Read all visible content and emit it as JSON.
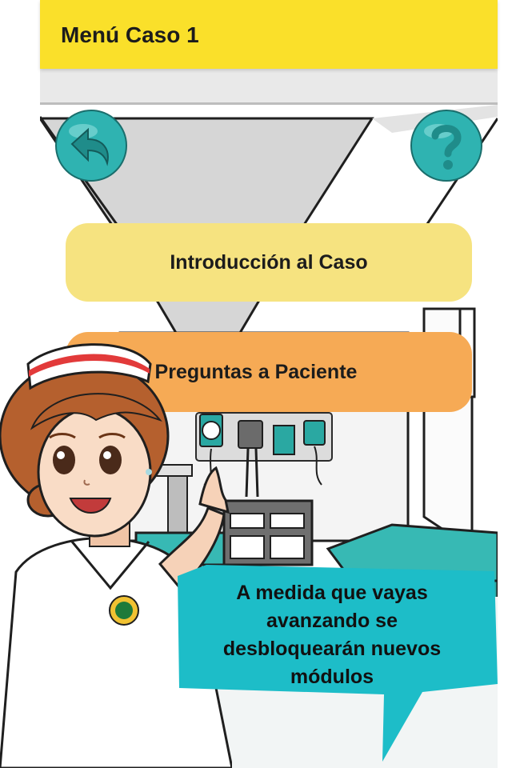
{
  "app_bar": {
    "title": "Menú Caso 1"
  },
  "nav": {
    "back_icon": "back-arrow-icon",
    "help_icon": "question-mark-icon"
  },
  "menu": {
    "intro_label": "Introducción al Caso",
    "questions_label": "Preguntas a Paciente"
  },
  "tip": {
    "lines": [
      "A medida que vayas",
      "avanzando se",
      "desbloquearán nuevos",
      "módulos"
    ]
  },
  "colors": {
    "app_bar": "#fae02a",
    "intro_button": "#f6e380",
    "questions_button": "#f6aa55",
    "circle_buttons": "#2fb3b1",
    "speech_bubble": "#1dbdc8"
  }
}
